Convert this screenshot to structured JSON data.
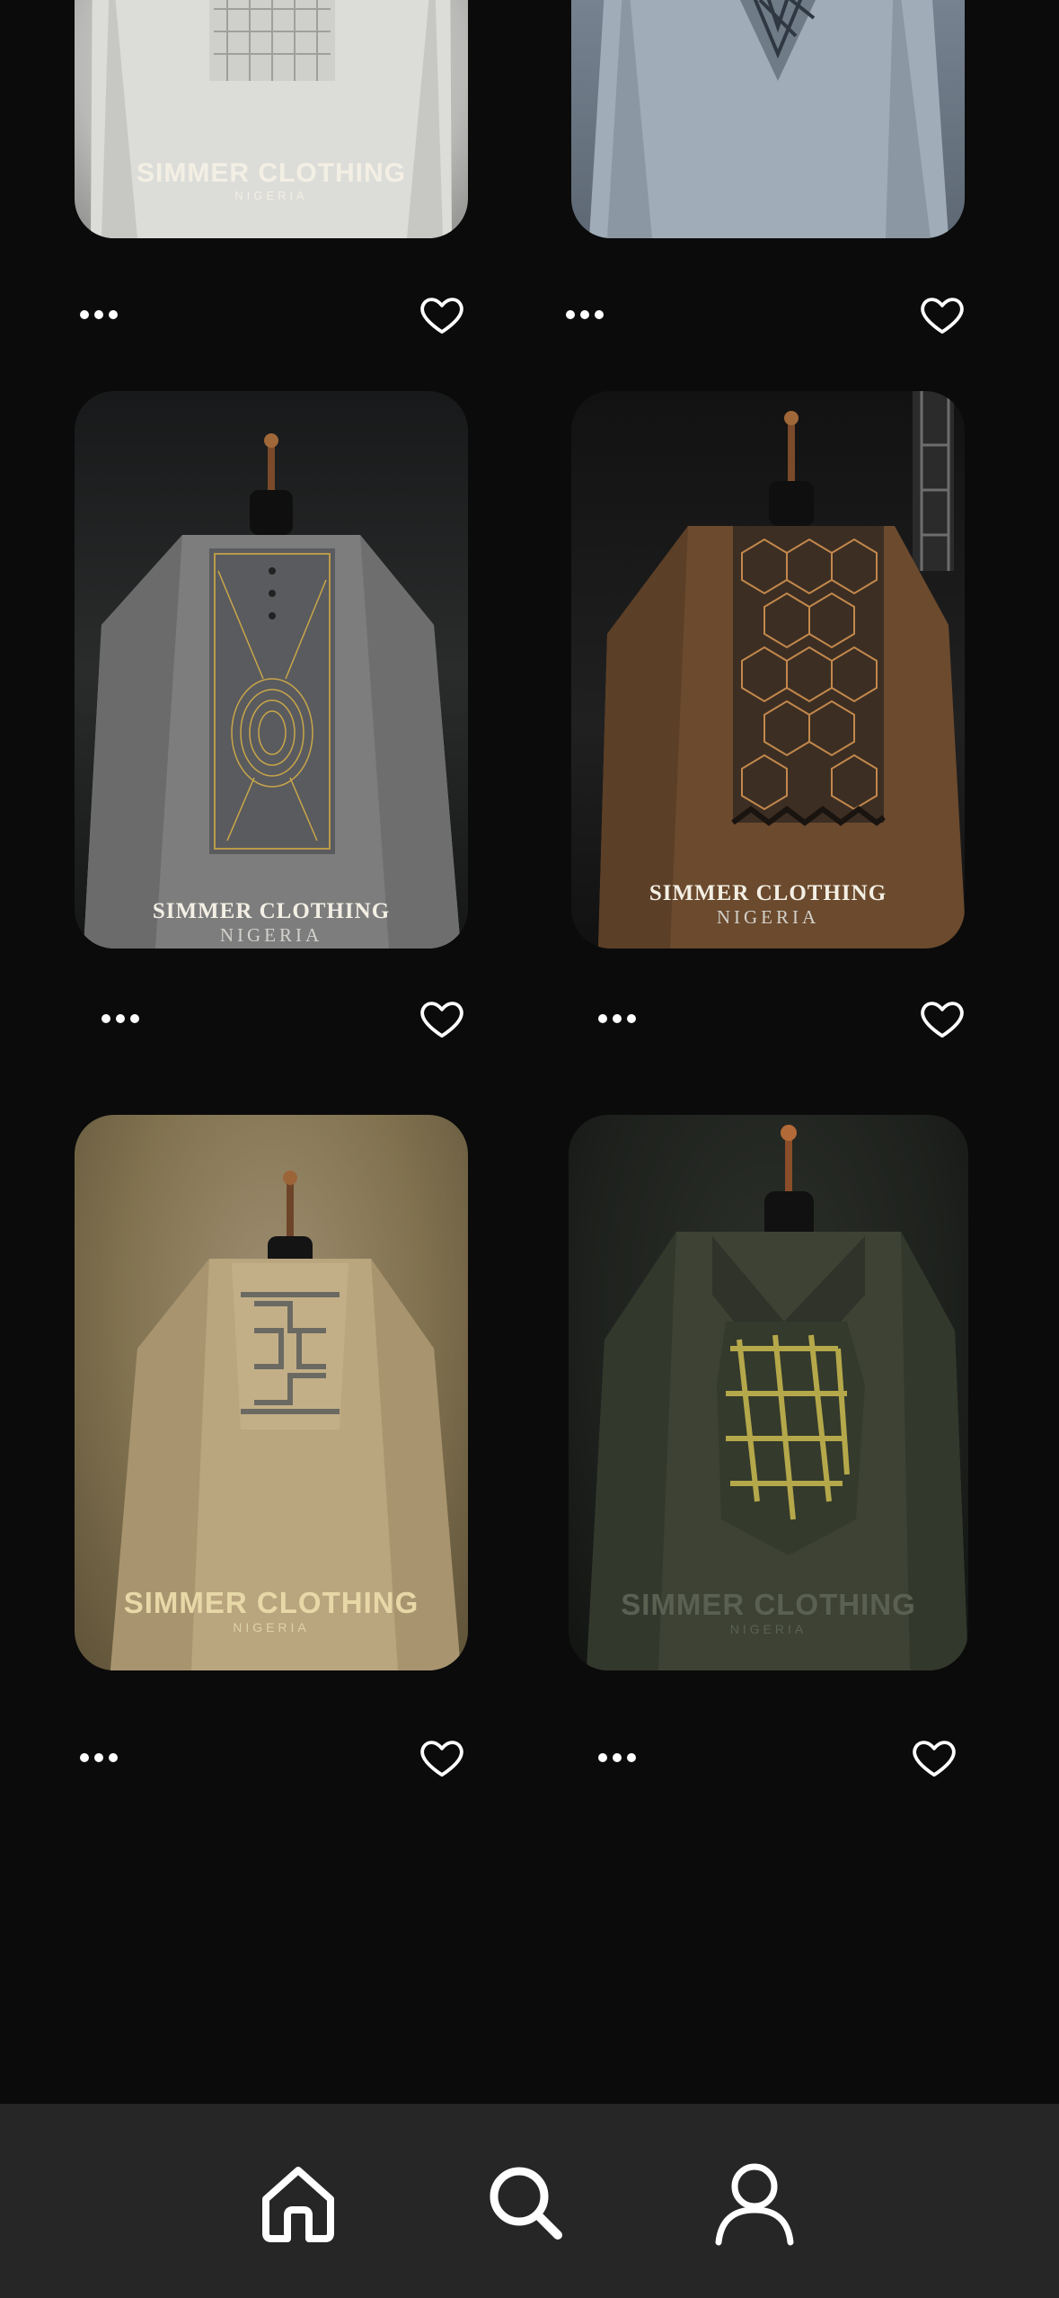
{
  "brand": {
    "name": "SIMMER CLOTHING",
    "sub": "NIGERIA"
  },
  "cards": [
    {
      "id": "card-1",
      "garment": "white agbada"
    },
    {
      "id": "card-2",
      "garment": "light blue agbada"
    },
    {
      "id": "card-3",
      "garment": "grey agbada with gold fingerprint embroidery"
    },
    {
      "id": "card-4",
      "garment": "brown agbada with hexagon embroidery"
    },
    {
      "id": "card-5",
      "garment": "beige agbada with cross pattern embroidery"
    },
    {
      "id": "card-6",
      "garment": "dark olive agbada with lattice embroidery"
    }
  ],
  "icons": {
    "more": "more-horizontal-icon",
    "like": "heart-outline-icon",
    "home": "home-icon",
    "search": "search-icon",
    "profile": "user-icon"
  },
  "colors": {
    "background": "#0b0b0b",
    "tabbar": "#262626",
    "icon": "#ffffff"
  }
}
